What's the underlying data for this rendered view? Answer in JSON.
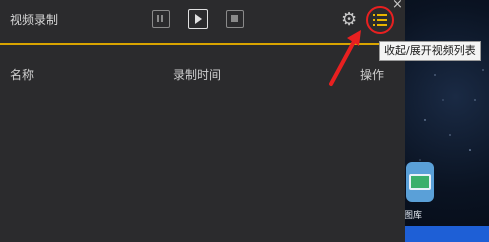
{
  "window": {
    "title": "视频录制"
  },
  "controls": {
    "pause": {
      "icon": "pause-icon"
    },
    "play": {
      "icon": "play-icon"
    },
    "stop": {
      "icon": "stop-icon"
    }
  },
  "toolbar_right": {
    "settings": {
      "icon": "gear-icon"
    },
    "toggle_list": {
      "icon": "list-icon"
    },
    "close": {
      "glyph": "×"
    }
  },
  "tooltip": {
    "text": "收起/展开视频列表"
  },
  "table": {
    "columns": [
      "名称",
      "录制时间",
      "操作"
    ]
  },
  "desktop": {
    "icon_label": "图库"
  },
  "colors": {
    "accent": "#d9a400",
    "highlight_circle": "#e82020",
    "panel_bg": "#2b2b2d"
  }
}
